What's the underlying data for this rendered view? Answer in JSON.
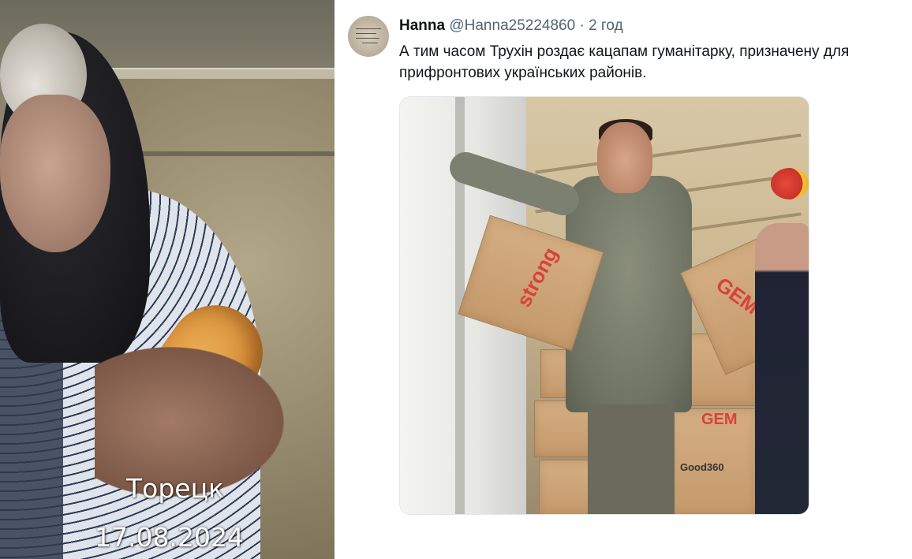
{
  "left_photo": {
    "overlay_city": "Торецк",
    "overlay_date": "17.08.2024"
  },
  "tweet": {
    "display_name": "Hanna",
    "handle": "@Hanna25224860",
    "separator": "·",
    "time": "2 год",
    "text": "А тим часом Трухін роздає кацапам гуманітарку, призначену для прифронтових українських районів."
  },
  "media": {
    "box_labels": [
      "strong",
      "GEM",
      "GEM",
      "Good360"
    ]
  },
  "colors": {
    "text_primary": "#0f1419",
    "text_secondary": "#536471",
    "gem_red": "#d9423a"
  }
}
